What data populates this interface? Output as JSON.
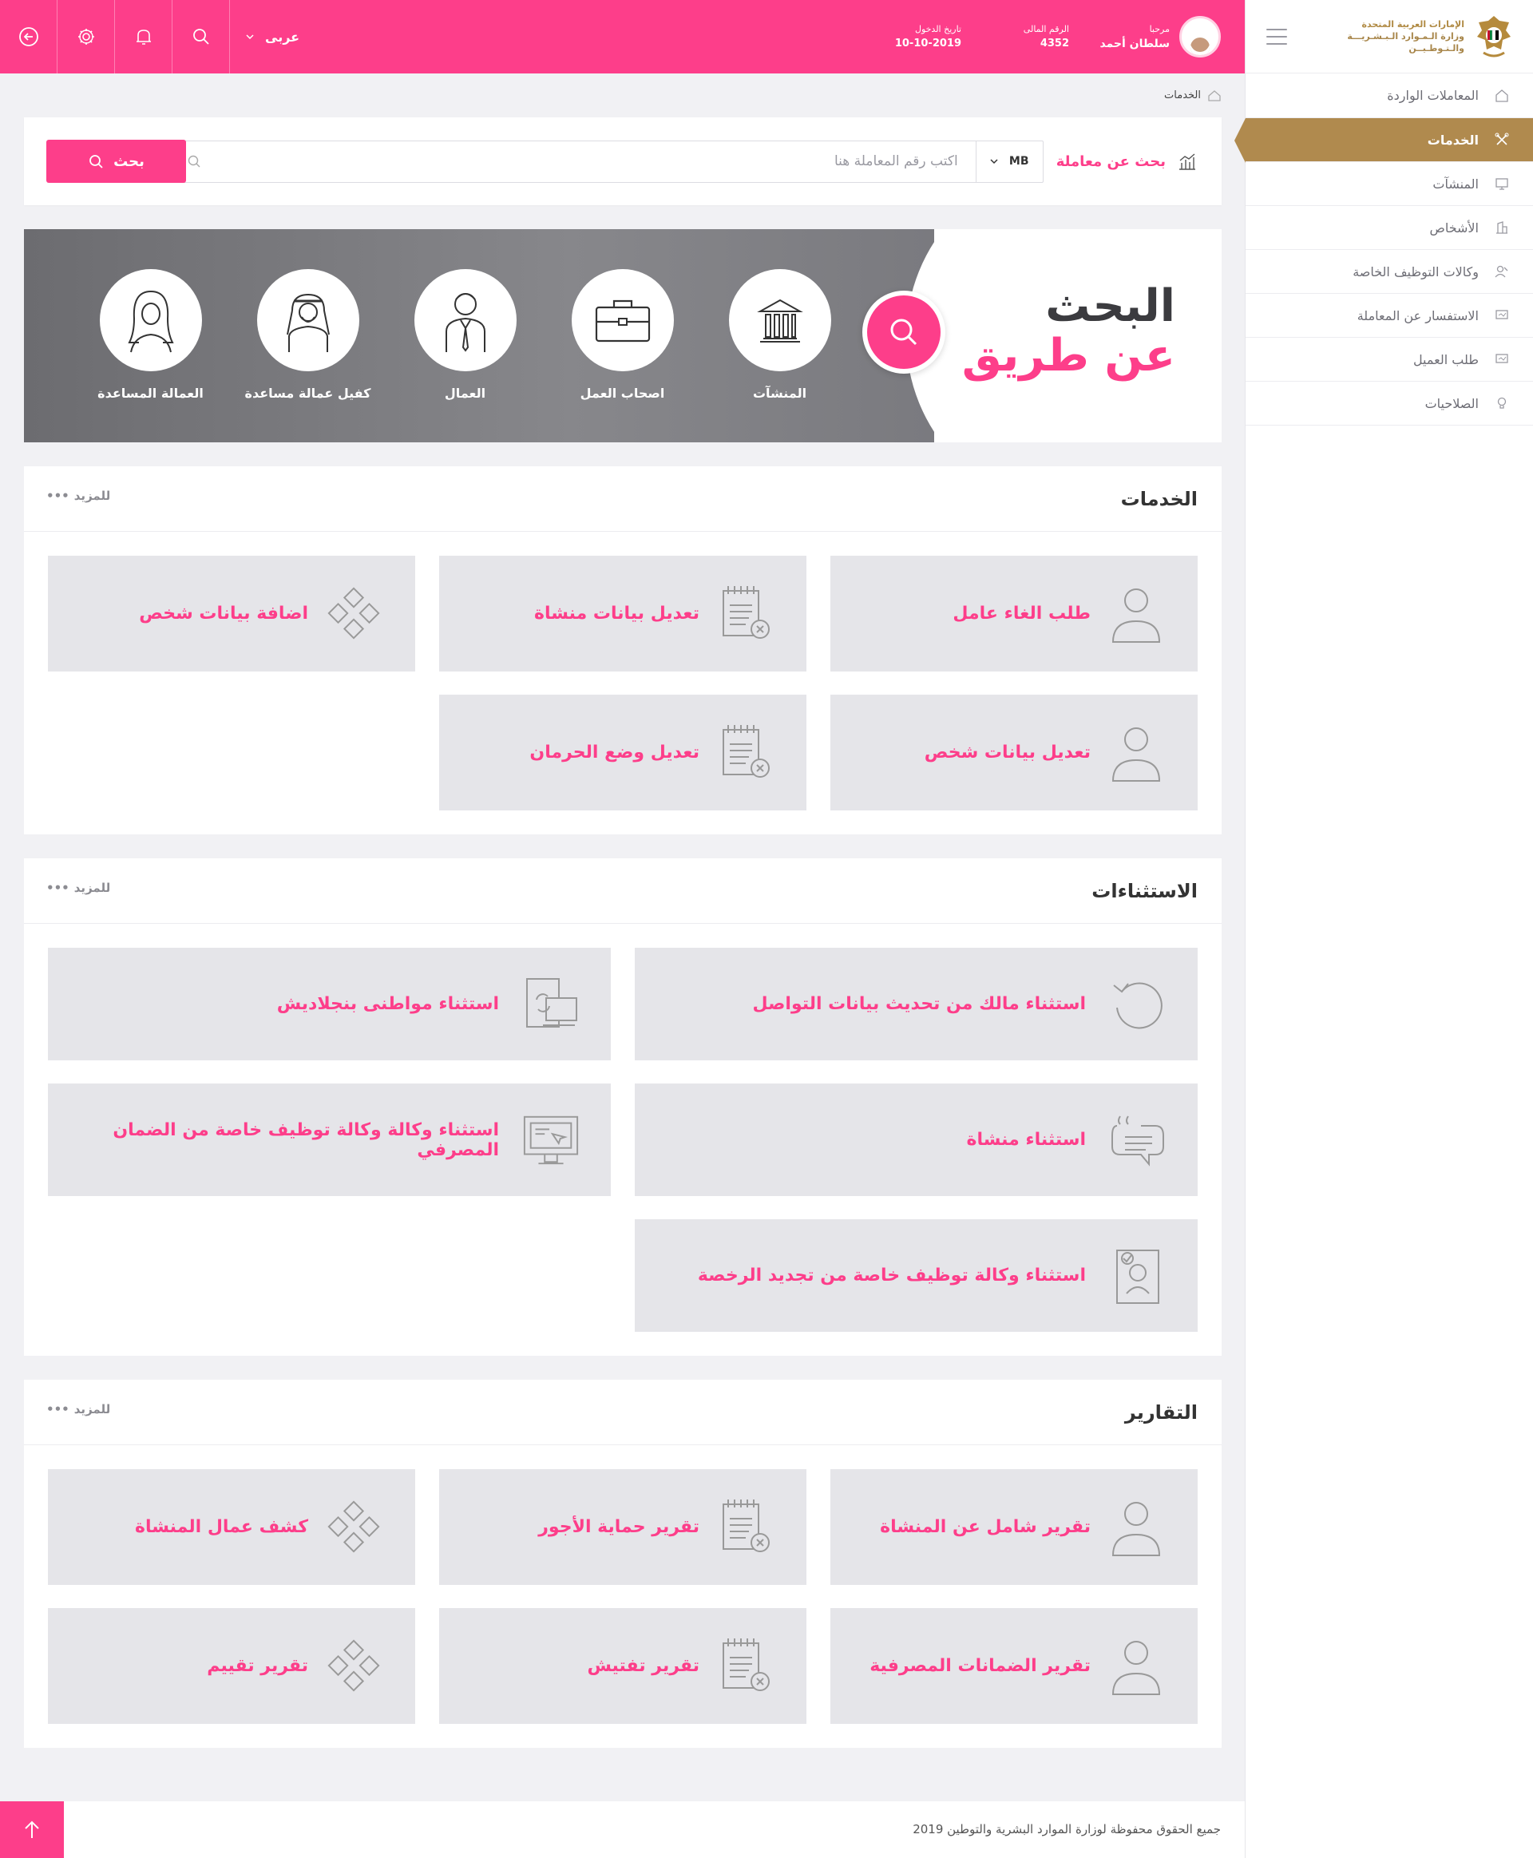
{
  "sidebar": {
    "ministry_line1": "الإمارات العربية المتحدة",
    "ministry_line2": "وزارة الـمـوارد الـبـشـريـــة",
    "ministry_line3": "والـتـوطـيــن",
    "items": [
      {
        "label": "المعاملات الواردة",
        "icon": "home-icon"
      },
      {
        "label": "الخدمات",
        "icon": "tools-icon",
        "active": true
      },
      {
        "label": "المنشآت",
        "icon": "monitor-icon"
      },
      {
        "label": "الأشخاص",
        "icon": "building-icon"
      },
      {
        "label": "وكالات التوظيف الخاصة",
        "icon": "user-edit-icon"
      },
      {
        "label": "الاستفسار عن المعاملة",
        "icon": "screen-icon"
      },
      {
        "label": "طلب العميل",
        "icon": "screen-icon"
      },
      {
        "label": "الصلاحيات",
        "icon": "bulb-icon"
      }
    ]
  },
  "topbar": {
    "welcome": "مرحبا",
    "user_name": "سلطان أحمد",
    "id_label": "الرقم المالى",
    "id_value": "4352",
    "date_label": "تاريخ الدخول",
    "date_value": "10-10-2019",
    "language": "عربى"
  },
  "breadcrumb": {
    "current": "الخدمات"
  },
  "search": {
    "title": "بحث عن معاملة",
    "prefix": "MB",
    "placeholder": "اكتب رقم المعاملة هنا",
    "button": "بحث"
  },
  "hero": {
    "line1": "البحث",
    "line2": "عن طريق",
    "categories": [
      {
        "label": "المنشآت",
        "icon": "institution-icon"
      },
      {
        "label": "اصحاب العمل",
        "icon": "briefcase-icon"
      },
      {
        "label": "العمال",
        "icon": "worker-icon"
      },
      {
        "label": "كفيل عمالة مساعدة",
        "icon": "sponsor-icon"
      },
      {
        "label": "العمالة المساعدة",
        "icon": "domestic-worker-icon"
      }
    ]
  },
  "sections": {
    "more_label": "للمزيد",
    "services": {
      "title": "الخدمات",
      "cards": [
        {
          "label": "طلب الغاء عامل",
          "icon": "person-icon"
        },
        {
          "label": "تعديل بيانات منشاة",
          "icon": "notepad-x-icon"
        },
        {
          "label": "اضافة بيانات شخص",
          "icon": "diamond-grid-icon"
        },
        {
          "label": "تعديل بيانات شخص",
          "icon": "person-icon"
        },
        {
          "label": "تعديل وضع الحرمان",
          "icon": "notepad-x-icon"
        }
      ]
    },
    "exceptions": {
      "title": "الاستثناءات",
      "cards": [
        {
          "label": "استثناء مالك من تحديث بيانات التواصل",
          "icon": "refresh-circle-icon"
        },
        {
          "label": "استثناء مواطنى بنجلاديش",
          "icon": "devices-sync-icon"
        },
        {
          "label": "استثناء منشاة",
          "icon": "quote-bubble-icon"
        },
        {
          "label": "استثناء وكالة وكالة توظيف خاصة من الضمان المصرفي",
          "icon": "monitor-cursor-icon"
        },
        {
          "label": "استثناء وكالة توظيف خاصة من تجديد الرخصة",
          "icon": "id-document-icon"
        }
      ]
    },
    "reports": {
      "title": "التقارير",
      "cards": [
        {
          "label": "تقرير شامل عن المنشاة",
          "icon": "person-icon"
        },
        {
          "label": "تقرير حماية الأجور",
          "icon": "notepad-x-icon"
        },
        {
          "label": "كشف عمال المنشاة",
          "icon": "diamond-grid-icon"
        },
        {
          "label": "تقرير الضمانات المصرفية",
          "icon": "person-icon"
        },
        {
          "label": "تقرير تفتيش",
          "icon": "notepad-x-icon"
        },
        {
          "label": "تقرير تقييم",
          "icon": "diamond-grid-icon"
        }
      ]
    }
  },
  "footer": {
    "copyright": "جميع الحقوق محفوظة لوزارة الموارد البشرية والتوطين 2019"
  },
  "colors": {
    "accent": "#fd3e8a",
    "gold": "#b08a4e",
    "card": "#e5e5e9"
  }
}
